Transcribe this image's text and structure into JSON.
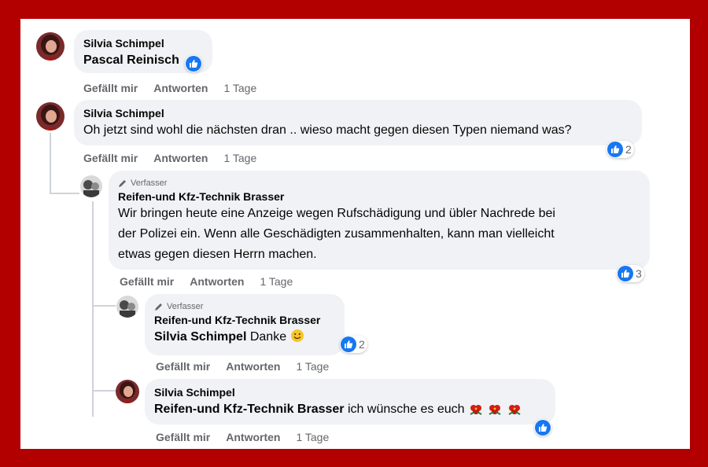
{
  "comments": [
    {
      "author": "Silvia Schimpel",
      "text": "Pascal Reinisch",
      "like_label": "Gefällt mir",
      "reply_label": "Antworten",
      "time": "1 Tage"
    },
    {
      "author": "Silvia Schimpel",
      "text": "Oh jetzt sind wohl die nächsten dran .. wieso macht gegen diesen Typen niemand was?",
      "like_label": "Gefällt mir",
      "reply_label": "Antworten",
      "time": "1 Tage",
      "reactions": "2"
    },
    {
      "badge": "Verfasser",
      "author": "Reifen-und Kfz-Technik Brasser",
      "text_lines": [
        "Wir bringen heute eine Anzeige wegen Rufschädigung und übler Nachrede bei",
        "der Polizei ein. Wenn alle Geschädigten zusammenhalten, kann man vielleicht",
        "etwas gegen diesen Herrn machen."
      ],
      "like_label": "Gefällt mir",
      "reply_label": "Antworten",
      "time": "1 Tage",
      "reactions": "3"
    },
    {
      "badge": "Verfasser",
      "author": "Reifen-und Kfz-Technik Brasser",
      "tag": "Silvia Schimpel",
      "text": "Danke",
      "like_label": "Gefällt mir",
      "reply_label": "Antworten",
      "time": "1 Tage",
      "reactions": "2"
    },
    {
      "author": "Silvia Schimpel",
      "tag": "Reifen-und Kfz-Technik Brasser",
      "text": "ich wünsche es euch",
      "like_label": "Gefällt mir",
      "reply_label": "Antworten",
      "time": "1 Tage"
    }
  ],
  "colors": {
    "frame": "#b20000",
    "bubble": "#f0f2f5",
    "like_blue": "#1877f2",
    "muted": "#65676b"
  },
  "icons": [
    "like-icon",
    "pencil-icon",
    "smiley-icon",
    "flower-icon"
  ]
}
